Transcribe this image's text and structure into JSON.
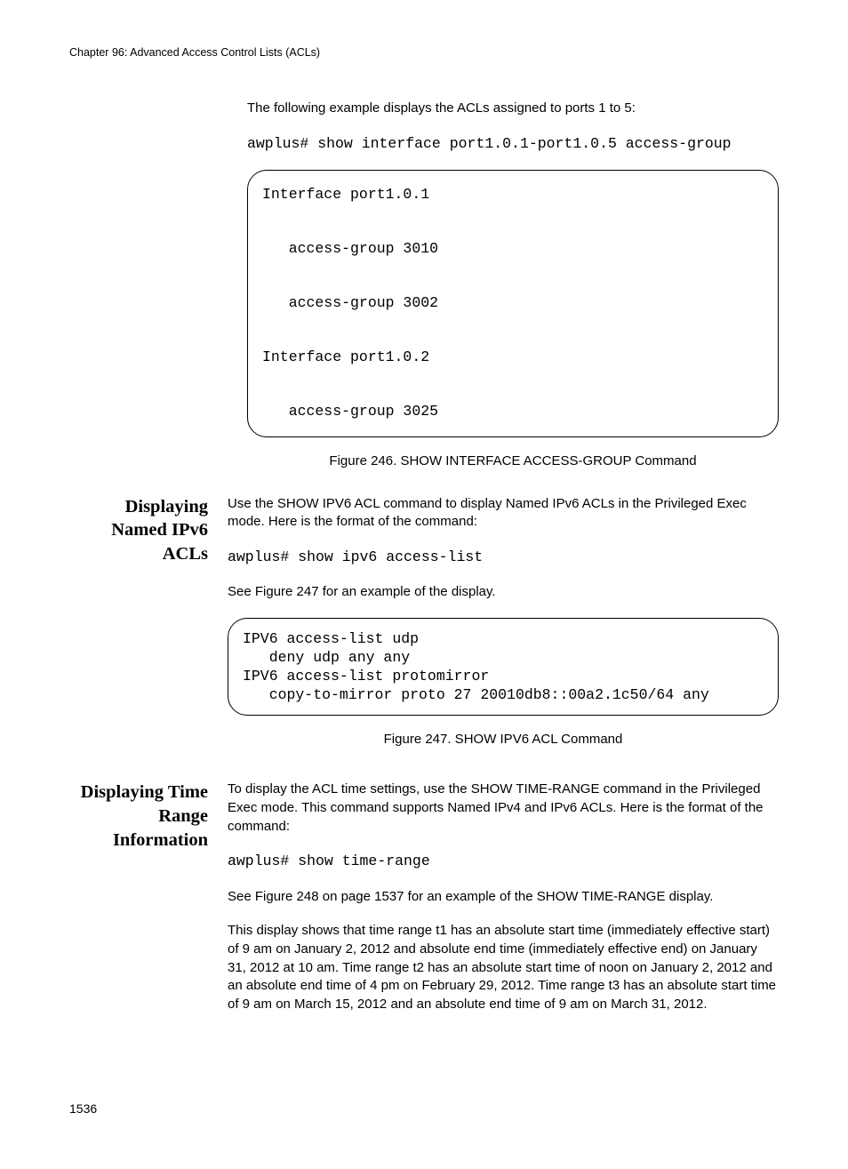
{
  "header": {
    "running": "Chapter 96: Advanced Access Control Lists (ACLs)"
  },
  "intro": {
    "para1": "The following example displays the ACLs assigned to ports 1 to 5:",
    "cmd1": "awplus# show interface port1.0.1-port1.0.5 access-group",
    "output1": "Interface port1.0.1\n\n   access-group 3010\n\n   access-group 3002\n\nInterface port1.0.2\n\n   access-group 3025",
    "fig246": "Figure 246. SHOW INTERFACE ACCESS-GROUP Command"
  },
  "sec_ipv6": {
    "heading": "Displaying Named IPv6 ACLs",
    "p1": "Use the SHOW IPV6 ACL command to display Named IPv6 ACLs in the Privileged Exec mode. Here is the format of the command:",
    "cmd": "awplus# show ipv6 access-list",
    "p2": "See Figure 247 for an example of the display.",
    "output": "IPV6 access-list udp\n   deny udp any any\nIPV6 access-list protomirror\n   copy-to-mirror proto 27 20010db8::00a2.1c50/64 any",
    "fig247": "Figure 247. SHOW IPV6 ACL Command"
  },
  "sec_time": {
    "heading": "Displaying Time Range Information",
    "p1": "To display the ACL time settings, use the SHOW TIME-RANGE command in the Privileged Exec mode. This command supports Named IPv4 and IPv6 ACLs. Here is the format of the command:",
    "cmd": "awplus# show time-range",
    "p2": "See Figure 248 on page 1537 for an example of the SHOW TIME-RANGE display.",
    "p3": "This display shows that time range t1 has an absolute start time (immediately effective start) of 9 am on January 2, 2012 and absolute end time (immediately effective end) on January 31, 2012 at 10 am. Time range t2 has an absolute start time of noon on January 2, 2012 and an absolute end time of 4 pm on February 29, 2012. Time range t3 has an absolute start time of 9 am on March 15, 2012 and an absolute end time of 9 am on March 31, 2012."
  },
  "footer": {
    "pagenum": "1536"
  }
}
